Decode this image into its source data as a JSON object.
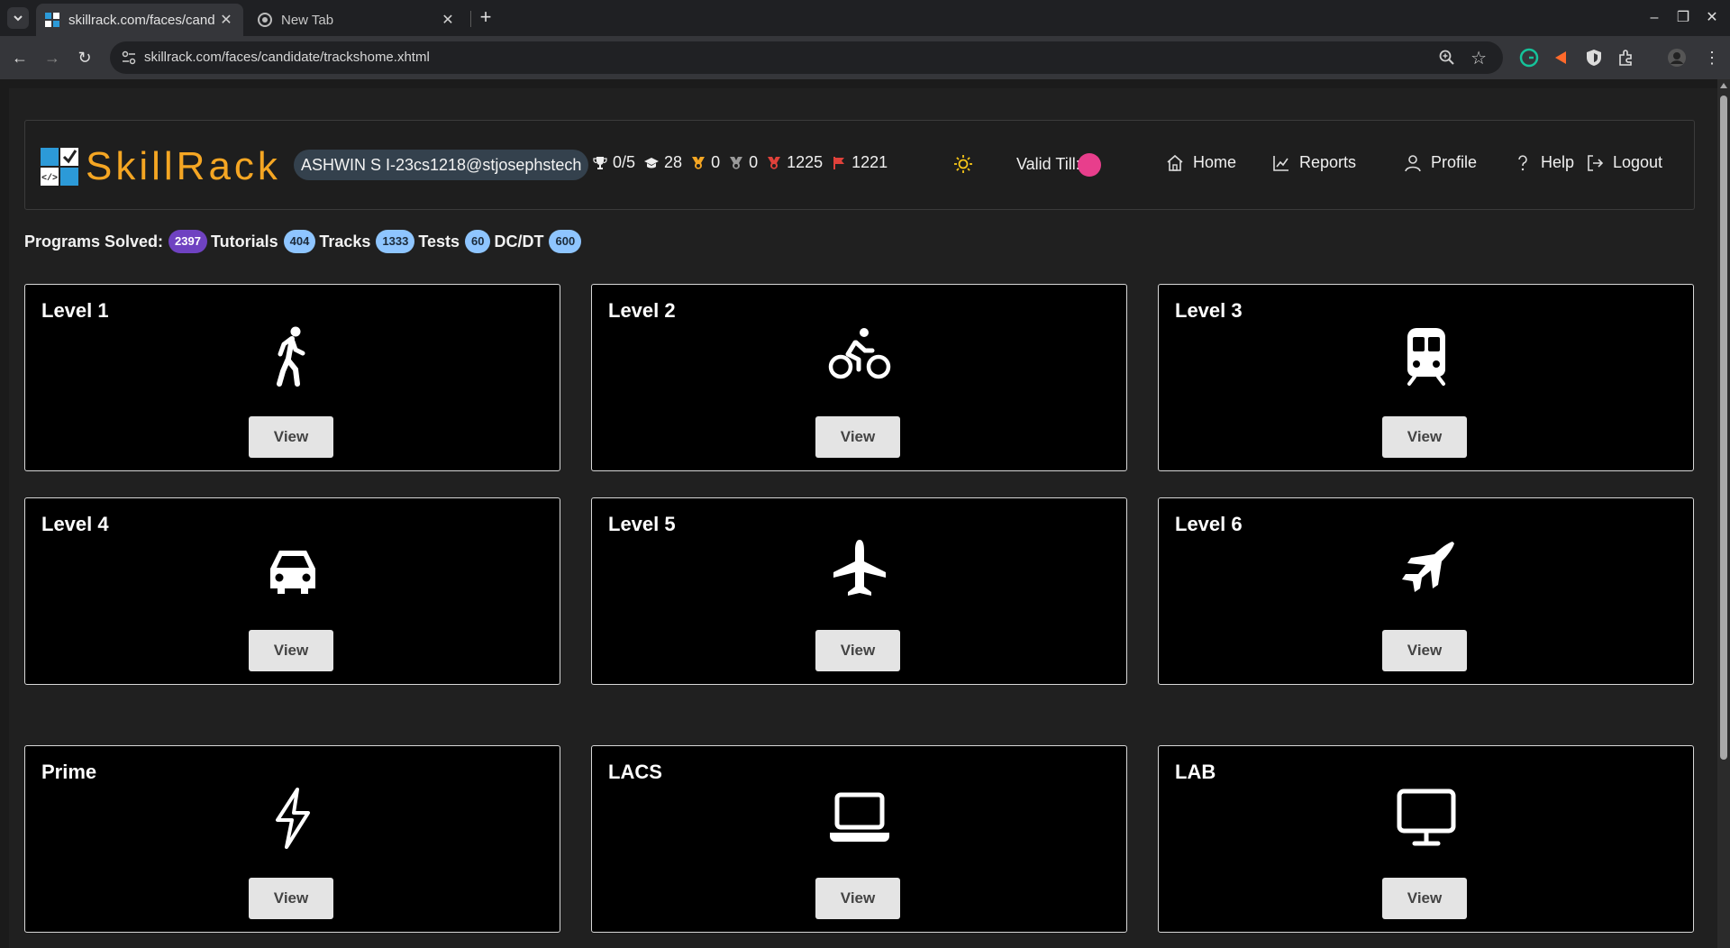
{
  "browser": {
    "tabs": [
      {
        "title": "skillrack.com/faces/cand",
        "active": true
      },
      {
        "title": "New Tab",
        "active": false
      }
    ],
    "url": "skillrack.com/faces/candidate/trackshome.xhtml"
  },
  "header": {
    "logo_text": "SkillRack",
    "user": "ASHWIN S I-23cs1218@stjosephstech",
    "stats": {
      "trophy": "0/5",
      "cap": "28",
      "gold": "0",
      "silver": "0",
      "bronze": "1225",
      "flag": "1221"
    },
    "valid_till_label": "Valid Till:",
    "nav": {
      "home": "Home",
      "reports": "Reports",
      "profile": "Profile",
      "help": "Help",
      "logout": "Logout"
    }
  },
  "counters": {
    "programs_label": "Programs Solved:",
    "programs_value": "2397",
    "tutorials_label": "Tutorials",
    "tutorials_value": "404",
    "tracks_label": "Tracks",
    "tracks_value": "1333",
    "tests_label": "Tests",
    "tests_value": "60",
    "dcdt_label": "DC/DT",
    "dcdt_value": "600"
  },
  "cards": [
    {
      "title": "Level 1",
      "icon": "walking-icon",
      "button": "View"
    },
    {
      "title": "Level 2",
      "icon": "bicycle-icon",
      "button": "View"
    },
    {
      "title": "Level 3",
      "icon": "train-icon",
      "button": "View"
    },
    {
      "title": "Level 4",
      "icon": "car-icon",
      "button": "View"
    },
    {
      "title": "Level 5",
      "icon": "plane-icon",
      "button": "View"
    },
    {
      "title": "Level 6",
      "icon": "fighter-jet-icon",
      "button": "View"
    },
    {
      "title": "Prime",
      "icon": "lightning-icon",
      "button": "View"
    },
    {
      "title": "LACS",
      "icon": "laptop-icon",
      "button": "View"
    },
    {
      "title": "LAB",
      "icon": "monitor-icon",
      "button": "View"
    }
  ],
  "colors": {
    "logo_orange": "#f5a623",
    "logo_blue": "#2c9ad8",
    "badge_purple": "#6f42c1",
    "badge_blue": "#8ec5ff",
    "valid_dot": "#e83e8c"
  }
}
